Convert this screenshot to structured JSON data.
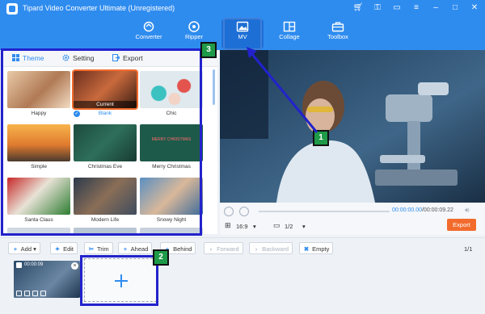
{
  "window": {
    "title": "Tipard Video Converter Ultimate (Unregistered)"
  },
  "nav": [
    {
      "label": "Converter",
      "icon": "converter-icon"
    },
    {
      "label": "Ripper",
      "icon": "ripper-icon"
    },
    {
      "label": "MV",
      "icon": "mv-icon",
      "active": true
    },
    {
      "label": "Collage",
      "icon": "collage-icon"
    },
    {
      "label": "Toolbox",
      "icon": "toolbox-icon"
    }
  ],
  "panel_tabs": [
    {
      "label": "Theme",
      "active": true
    },
    {
      "label": "Setting"
    },
    {
      "label": "Export"
    }
  ],
  "themes": [
    {
      "name": "Happy"
    },
    {
      "name": "Blank",
      "selected": true,
      "overlay": "Current"
    },
    {
      "name": "Chic"
    },
    {
      "name": "Simple"
    },
    {
      "name": "Christmas Eve"
    },
    {
      "name": "Merry Christmas",
      "thumb_text": "MERRY CHRISTMAS"
    },
    {
      "name": "Santa Claus"
    },
    {
      "name": "Modern Life"
    },
    {
      "name": "Snowy Night"
    }
  ],
  "player": {
    "current_time": "00:00:00.00",
    "total_time": "/00:00:09.22",
    "aspect_ratio": "16:9",
    "page": "1/2",
    "export_label": "Export"
  },
  "toolbar": {
    "add": "Add",
    "edit": "Edit",
    "trim": "Trim",
    "ahead": "Ahead",
    "behind": "Behind",
    "forward": "Forward",
    "backward": "Backward",
    "empty": "Empty",
    "count": "1/1"
  },
  "timeline": {
    "clip_time": "00:00:09"
  },
  "annotations": {
    "badge1": "1",
    "badge2": "2",
    "badge3": "3"
  },
  "colors": {
    "brand": "#2f8cef",
    "accent": "#f26b2d",
    "annotation": "#2222cc",
    "badge": "#1f9a48"
  }
}
